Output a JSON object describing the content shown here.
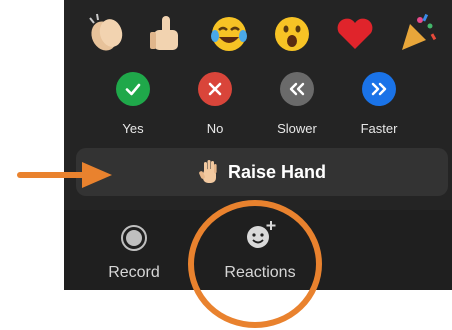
{
  "reactions_panel": {
    "emojis": [
      {
        "icon": "clap-icon"
      },
      {
        "icon": "thumbs-up-icon"
      },
      {
        "icon": "tears-of-joy-icon"
      },
      {
        "icon": "open-mouth-icon"
      },
      {
        "icon": "heart-icon"
      },
      {
        "icon": "party-popper-icon"
      }
    ],
    "buttons": [
      {
        "label": "Yes",
        "icon": "check-icon",
        "color": "#1fa84a"
      },
      {
        "label": "No",
        "icon": "x-icon",
        "color": "#d9453a"
      },
      {
        "label": "Slower",
        "icon": "rewind-icon",
        "color": "#6a6a6a"
      },
      {
        "label": "Faster",
        "icon": "fast-forward-icon",
        "color": "#1a73e8"
      }
    ],
    "raise_hand": {
      "label": "Raise Hand",
      "icon": "raised-hand-icon"
    }
  },
  "toolbar": {
    "record": {
      "label": "Record",
      "icon": "record-icon"
    },
    "reactions": {
      "label": "Reactions",
      "icon": "add-reaction-icon"
    }
  },
  "annotations": {
    "color": "#e9822e"
  }
}
